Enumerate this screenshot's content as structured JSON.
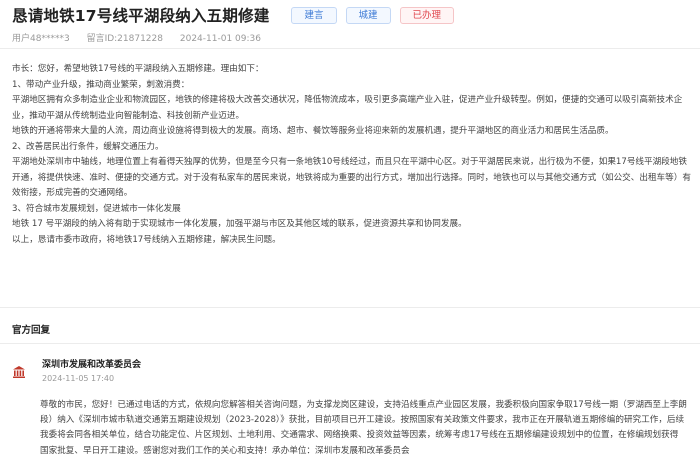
{
  "header": {
    "title": "恳请地铁17号线平湖段纳入五期修建",
    "tags": [
      "建言",
      "城建",
      "已办理"
    ]
  },
  "meta": {
    "user": "用户48*****3",
    "message_id": "留言ID:21871228",
    "datetime": "2024-11-01 09:36"
  },
  "message": {
    "lines": [
      "市长：您好，希望地铁17号线的平湖段纳入五期修建。理由如下：",
      "1、带动产业升级，推动商业繁荣，刺激消费：",
      "平湖地区拥有众多制造业企业和物流园区，地铁的修建将极大改善交通状况，降低物流成本，吸引更多高端产业入驻，促进产业升级转型。例如，便捷的交通可以吸引高新技术企",
      "业，推动平湖从传统制造业向智能制造、科技创新产业迈进。",
      "地铁的开通将带来大量的人流，周边商业设施将得到极大的发展。商场、超市、餐饮等服务业将迎来新的发展机遇，提升平湖地区的商业活力和居民生活品质。",
      "2、改善居民出行条件，缓解交通压力。",
      "平湖地处深圳市中轴线，地理位置上有着得天独厚的优势，但是至今只有一条地铁10号线经过，而且只在平湖中心区。对于平湖居民来说，出行极为不便，如果17号线平湖段地铁",
      "开通，将提供快速、准时、便捷的交通方式。对于没有私家车的居民来说，地铁将成为重要的出行方式，增加出行选择。同时，地铁也可以与其他交通方式（如公交、出租车等）有",
      "效衔接，形成完善的交通网络。",
      "3、符合城市发展规划，促进城市一体化发展",
      "地铁 17 号平湖段的纳入将有助于实现城市一体化发展，加强平湖与市区及其他区域的联系，促进资源共享和协同发展。",
      "以上，恳请市委市政府，将地铁17号线纳入五期修建，解决民生问题。"
    ]
  },
  "reply": {
    "heading": "官方回复",
    "agency": "深圳市发展和改革委员会",
    "datetime": "2024-11-05 17:40",
    "lines": [
      "尊敬的市民，您好！已通过电话的方式，依规向您解答相关咨询问题，为支撑龙岗区建设，支持沿线重点产业园区发展，我委积极向国家争取17号线一期（罗湖西至上李朗",
      "段）纳入《深圳市城市轨道交通第五期建设规划（2023-2028）》获批，目前项目已开工建设。按照国家有关政策文件要求，我市正在开展轨道五期修编的研究工作，后续",
      "我委将会同各相关单位，结合功能定位、片区规划、土地利用、交通需求、网络换乘、投资效益等因素，统筹考虑17号线在五期修编建设规划中的位置，在修编规划获得",
      "国家批复、早日开工建设。感谢您对我们工作的关心和支持！承办单位：深圳市发展和改革委员会"
    ]
  },
  "colors": {
    "tag_blue": "#3f7bd6",
    "tag_red": "#e0484f",
    "agency_icon": "#c0392b"
  }
}
